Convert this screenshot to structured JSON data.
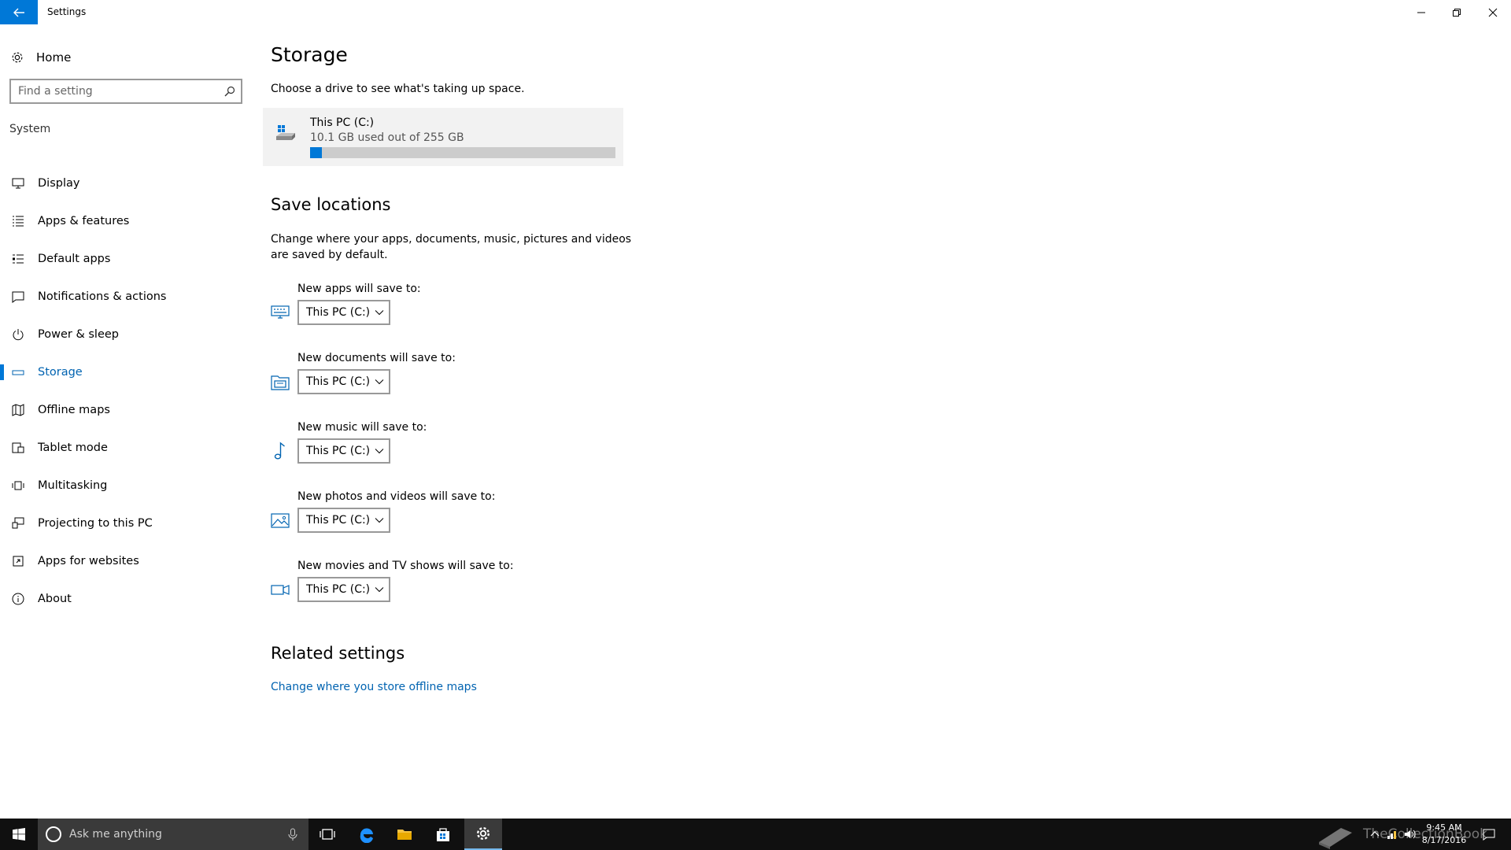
{
  "window": {
    "title": "Settings"
  },
  "sidebar": {
    "home_label": "Home",
    "search_placeholder": "Find a setting",
    "section_label": "System",
    "items": [
      {
        "label": "Display",
        "icon": "display-icon"
      },
      {
        "label": "Apps & features",
        "icon": "list-icon"
      },
      {
        "label": "Default apps",
        "icon": "default-apps-icon"
      },
      {
        "label": "Notifications & actions",
        "icon": "notification-icon"
      },
      {
        "label": "Power & sleep",
        "icon": "power-icon"
      },
      {
        "label": "Storage",
        "icon": "storage-icon",
        "active": true
      },
      {
        "label": "Offline maps",
        "icon": "map-icon"
      },
      {
        "label": "Tablet mode",
        "icon": "tablet-icon"
      },
      {
        "label": "Multitasking",
        "icon": "multitasking-icon"
      },
      {
        "label": "Projecting to this PC",
        "icon": "project-icon"
      },
      {
        "label": "Apps for websites",
        "icon": "web-apps-icon"
      },
      {
        "label": "About",
        "icon": "info-icon"
      }
    ]
  },
  "main": {
    "title": "Storage",
    "description": "Choose a drive to see what's taking up space.",
    "drive": {
      "name": "This PC (C:)",
      "usage": "10.1 GB used out of 255 GB",
      "used_fraction": 0.0396
    },
    "save_locations": {
      "title": "Save locations",
      "description": "Change where your apps, documents, music, pictures and videos are saved by default.",
      "rows": [
        {
          "label": "New apps will save to:",
          "value": "This PC (C:)",
          "icon": "apps-keyboard-icon"
        },
        {
          "label": "New documents will save to:",
          "value": "This PC (C:)",
          "icon": "documents-icon"
        },
        {
          "label": "New music will save to:",
          "value": "This PC (C:)",
          "icon": "music-icon"
        },
        {
          "label": "New photos and videos will save to:",
          "value": "This PC (C:)",
          "icon": "photo-icon"
        },
        {
          "label": "New movies and TV shows will save to:",
          "value": "This PC (C:)",
          "icon": "video-icon"
        }
      ]
    },
    "related": {
      "title": "Related settings",
      "link": "Change where you store offline maps"
    }
  },
  "taskbar": {
    "search_placeholder": "Ask me anything",
    "time": "9:45 AM",
    "date": "8/17/2016",
    "watermark": "TheCollectionBook"
  },
  "colors": {
    "accent": "#0078d7",
    "link": "#0063b1",
    "taskbar": "#101010"
  }
}
